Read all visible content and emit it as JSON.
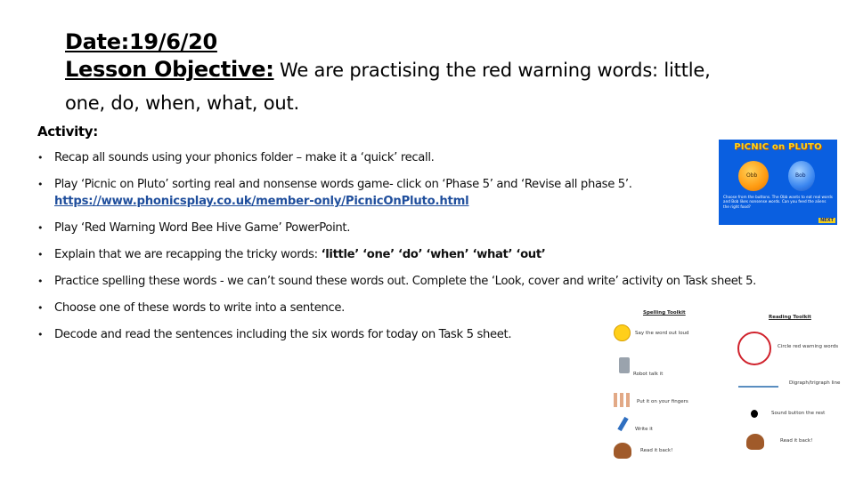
{
  "header": {
    "date_label": "Date:19/6/20",
    "objective_label": "Lesson Objective:",
    "objective_text_line1": " We are practising the red warning words: little,",
    "objective_text_line2": "one, do, when, what, out."
  },
  "activity": {
    "title": "Activity:",
    "bullet_glyph": "•",
    "items": [
      {
        "text": "Recap all sounds using your phonics folder – make it a ‘quick’ recall."
      },
      {
        "text": "Play ‘Picnic on Pluto’ sorting real and nonsense words game- click on ‘Phase 5’ and ‘Revise all phase 5’.",
        "link": "https://www.phonicsplay.co.uk/member-only/PicnicOnPluto.html"
      },
      {
        "text": "Play ‘Red Warning Word Bee Hive Game’ PowerPoint."
      },
      {
        "text_prefix": "Explain that we are recapping the tricky words: ",
        "text_bold": "‘little’ ‘one’ ‘do’ ‘when’ ‘what’ ‘out’"
      },
      {
        "text": "Practice spelling these words - we can’t sound these words out. Complete the ‘Look, cover and write’ activity on Task sheet 5."
      },
      {
        "text": "Choose one of these words to write into a sentence."
      },
      {
        "text": "Decode and read the sentences including the six words for today on Task 5 sheet."
      }
    ]
  },
  "picnic_image": {
    "title": "PICNIC on PLUTO",
    "alien_left_name": "Obb",
    "alien_right_name": "Bob",
    "description": "Choose from the buttons. The Obb wants to eat real words and Bob likes nonsense words. Can you feed the aliens the right food?",
    "next_label": "NEXT",
    "colors": {
      "background": "#0a5fe0",
      "title": "#ffd21a"
    }
  },
  "toolkits_image": {
    "spelling": {
      "title": "Spelling Toolkit",
      "items": [
        "Say the word out loud",
        "Robot talk it",
        "Put it on your fingers",
        "Write it",
        "Read it back!"
      ]
    },
    "reading": {
      "title": "Reading Toolkit",
      "items": [
        "Circle red warning words",
        "Digraph/trigraph line",
        "Sound button the rest",
        "Read it back!"
      ]
    }
  }
}
